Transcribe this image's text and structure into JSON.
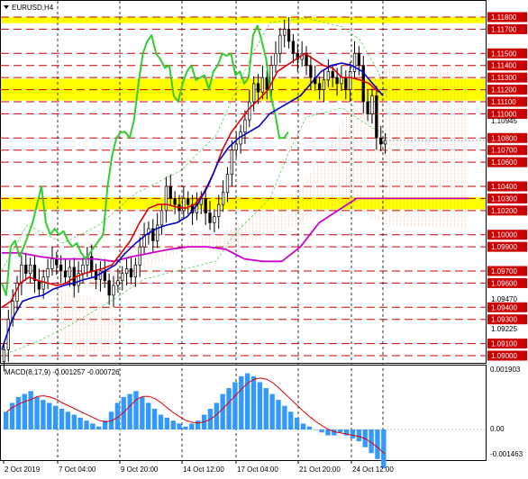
{
  "chart": {
    "symbol_title": "EURUSD,H4",
    "macd_title": "MACD(8,17,9) -0.001257 -0.000726",
    "macd_label_top": "0.001903",
    "macd_label_zero": "0.00",
    "macd_label_bottom": "-0.001463",
    "colors": {
      "resistance_band": "#ffff00",
      "level_line": "#cc0000",
      "price_tag": "#cc0000",
      "ma_green": "#33cc33",
      "ma_red": "#dd0000",
      "ma_blue": "#0000cc",
      "ma_magenta": "#cc00cc",
      "histogram": "#3399ff",
      "signal": "#dd0000"
    }
  },
  "chart_data": {
    "type": "candlestick",
    "title": "EURUSD,H4",
    "ylim": [
      1.0895,
      1.1185
    ],
    "price_axis_labels": [
      {
        "value": 1.118,
        "label": "1.11800",
        "highlight": true
      },
      {
        "value": 1.117,
        "label": "1.11700",
        "highlight": true
      },
      {
        "value": 1.115,
        "label": "1.11500",
        "highlight": true
      },
      {
        "value": 1.114,
        "label": "1.11400",
        "highlight": true
      },
      {
        "value": 1.113,
        "label": "1.11300",
        "highlight": true
      },
      {
        "value": 1.112,
        "label": "1.11200",
        "highlight": true
      },
      {
        "value": 1.111,
        "label": "1.11100",
        "highlight": true
      },
      {
        "value": 1.11,
        "label": "1.11000",
        "highlight": true
      },
      {
        "value": 1.10945,
        "label": "1.10945",
        "highlight": false
      },
      {
        "value": 1.108,
        "label": "1.10800",
        "highlight": true
      },
      {
        "value": 1.107,
        "label": "1.10700",
        "highlight": true
      },
      {
        "value": 1.106,
        "label": "1.10600",
        "highlight": true
      },
      {
        "value": 1.104,
        "label": "1.10400",
        "highlight": true
      },
      {
        "value": 1.103,
        "label": "1.10300",
        "highlight": true
      },
      {
        "value": 1.102,
        "label": "1.10200",
        "highlight": true
      },
      {
        "value": 1.1,
        "label": "1.10000",
        "highlight": true
      },
      {
        "value": 1.099,
        "label": "1.09900",
        "highlight": true
      },
      {
        "value": 1.097,
        "label": "1.09700",
        "highlight": true
      },
      {
        "value": 1.096,
        "label": "1.09600",
        "highlight": true
      },
      {
        "value": 1.0947,
        "label": "1.09470",
        "highlight": false
      },
      {
        "value": 1.094,
        "label": "1.09400",
        "highlight": true
      },
      {
        "value": 1.093,
        "label": "1.09300",
        "highlight": true
      },
      {
        "value": 1.09225,
        "label": "1.09225",
        "highlight": false
      },
      {
        "value": 1.091,
        "label": "1.09100",
        "highlight": true
      },
      {
        "value": 1.09,
        "label": "1.09000",
        "highlight": true
      }
    ],
    "level_lines": [
      1.118,
      1.117,
      1.115,
      1.114,
      1.113,
      1.112,
      1.111,
      1.11,
      1.108,
      1.107,
      1.106,
      1.104,
      1.103,
      1.102,
      1.1,
      1.099,
      1.097,
      1.096,
      1.094,
      1.093,
      1.091,
      1.09
    ],
    "bands": [
      {
        "from": 1.118,
        "to": 1.1175
      },
      {
        "from": 1.1129,
        "to": 1.1111
      },
      {
        "from": 1.1031,
        "to": 1.1021
      }
    ],
    "time_labels": [
      "2 Oct 2019",
      "7 Oct 04:00",
      "9 Oct 20:00",
      "14 Oct 12:00",
      "17 Oct 04:00",
      "21 Oct 20:00",
      "24 Oct 12:00"
    ],
    "close": [
      1.0905,
      1.093,
      1.0945,
      1.096,
      1.0975,
      1.0968,
      1.0975,
      1.0962,
      1.0955,
      1.0965,
      1.0972,
      1.098,
      1.0975,
      1.097,
      1.0965,
      1.0973,
      1.0958,
      1.0968,
      1.0975,
      1.0982,
      1.097,
      1.0963,
      1.097,
      1.0962,
      1.095,
      1.0958,
      1.0962,
      1.0968,
      1.0972,
      1.0965,
      1.0975,
      1.099,
      1.1,
      1.1005,
      1.0995,
      1.1008,
      1.102,
      1.104,
      1.103,
      1.1025,
      1.102,
      1.103,
      1.1025,
      1.1018,
      1.1025,
      1.103,
      1.1018,
      1.101,
      1.1015,
      1.1025,
      1.1035,
      1.105,
      1.107,
      1.1075,
      1.1085,
      1.1095,
      1.111,
      1.1125,
      1.1118,
      1.113,
      1.112,
      1.114,
      1.115,
      1.1165,
      1.117,
      1.116,
      1.115,
      1.1145,
      1.115,
      1.114,
      1.113,
      1.1125,
      1.112,
      1.1128,
      1.1135,
      1.113,
      1.1125,
      1.113,
      1.112,
      1.1135,
      1.115,
      1.114,
      1.111,
      1.11,
      1.1115,
      1.108,
      1.1075,
      1.1078
    ],
    "ma_green": [
      1.096,
      1.095,
      1.099,
      1.0995,
      1.0982,
      1.099,
      1.1,
      1.101,
      1.1025,
      1.104,
      1.101,
      1.1,
      1.1005,
      1.1,
      1.1003,
      1.0995,
      1.099,
      1.0993,
      1.0985,
      1.098,
      1.0985,
      1.099,
      1.0995,
      1.1,
      1.104,
      1.1065,
      1.108,
      1.1085,
      1.1085,
      1.108,
      1.1095,
      1.1125,
      1.115,
      1.116,
      1.1165,
      1.115,
      1.1145,
      1.1138,
      1.114,
      1.1115,
      1.111,
      1.1125,
      1.1135,
      1.114,
      1.1128,
      1.113,
      1.1132,
      1.112,
      1.1135,
      1.114,
      1.115,
      1.1148,
      1.115,
      1.1132,
      1.1135,
      1.1125,
      1.113,
      1.1165,
      1.1173,
      1.116,
      1.1145,
      1.1115,
      1.11,
      1.108,
      1.108,
      1.1085
    ],
    "ma_red": [
      1.094,
      1.0945,
      1.096,
      1.0965,
      1.0962,
      1.096,
      1.0958,
      1.096,
      1.0965,
      1.0968,
      1.097,
      1.0972,
      1.0975,
      1.0985,
      1.0995,
      1.101,
      1.1022,
      1.1025,
      1.1025,
      1.1023,
      1.1022,
      1.1025,
      1.1035,
      1.105,
      1.107,
      1.1085,
      1.1095,
      1.1105,
      1.1112,
      1.112,
      1.1135,
      1.114,
      1.1145,
      1.115,
      1.1145,
      1.114,
      1.1138,
      1.113,
      1.113,
      1.1128,
      1.1125,
      1.1118
    ],
    "ma_blue": [
      1.0905,
      1.093,
      1.0945,
      1.0948,
      1.095,
      1.0955,
      1.0958,
      1.096,
      1.0963,
      1.0965,
      1.097,
      1.0975,
      1.0985,
      1.0993,
      1.1,
      1.1005,
      1.1008,
      1.101,
      1.1015,
      1.1025,
      1.104,
      1.106,
      1.1072,
      1.108,
      1.1085,
      1.109,
      1.11,
      1.1105,
      1.111,
      1.1115,
      1.1125,
      1.1135,
      1.114,
      1.1142,
      1.114,
      1.1135,
      1.1125,
      1.1115
    ],
    "ma_magenta": [
      1.0985,
      1.0985,
      1.0982,
      1.098,
      1.098,
      1.098,
      1.0978,
      1.0982,
      1.0985,
      1.0988,
      1.099,
      1.099,
      1.0988,
      1.098,
      1.0978,
      1.0978,
      1.099,
      1.101,
      1.102,
      1.103,
      1.103,
      1.103,
      1.103,
      1.103,
      1.103,
      1.103
    ],
    "macd_hist": [
      0.0006,
      0.0009,
      0.0011,
      0.0012,
      0.0013,
      0.0011,
      0.001,
      0.0009,
      0.0008,
      0.0007,
      0.0006,
      0.0005,
      0.0004,
      0.0003,
      0.0002,
      0.0001,
      0.0003,
      0.0006,
      0.0009,
      0.0011,
      0.0012,
      0.0013,
      0.0011,
      0.0009,
      0.0007,
      0.0005,
      0.0004,
      0.0003,
      0.0002,
      0.0001,
      0.0002,
      0.0003,
      0.0005,
      0.0007,
      0.0009,
      0.0012,
      0.0014,
      0.0016,
      0.0018,
      0.0019,
      0.0018,
      0.0016,
      0.0014,
      0.0012,
      0.001,
      0.0008,
      0.0006,
      0.0004,
      0.0002,
      0.0001,
      0.0,
      -0.0001,
      -0.0002,
      -0.0002,
      -0.0001,
      -0.0002,
      -0.0003,
      -0.0004,
      -0.0006,
      -0.0008,
      -0.001,
      -0.0013
    ],
    "macd_ylim": [
      -0.0015,
      0.002
    ]
  }
}
